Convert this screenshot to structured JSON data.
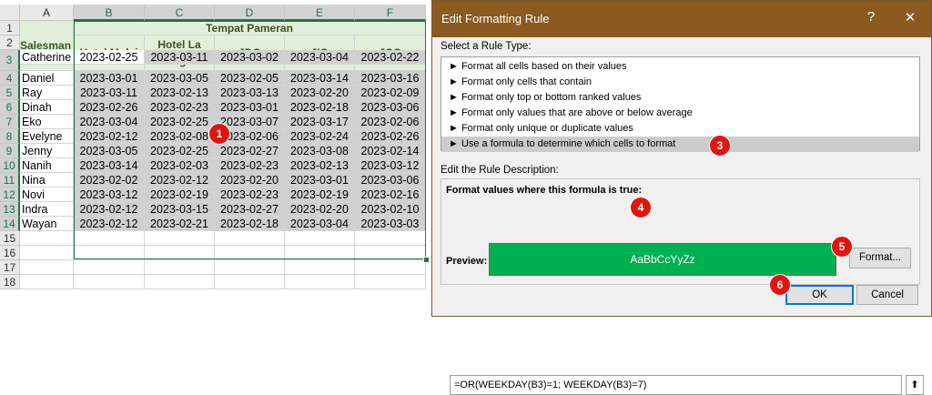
{
  "spreadsheet": {
    "column_letters": [
      "A",
      "B",
      "C",
      "D",
      "E",
      "F"
    ],
    "row_numbers": [
      "1",
      "2",
      "3",
      "4",
      "5",
      "6",
      "7",
      "8",
      "9",
      "10",
      "11",
      "12",
      "13",
      "14",
      "15",
      "16",
      "17",
      "18"
    ],
    "merged_header": "Tempat Pameran",
    "salesman_header": "Salesman",
    "venue_headers": [
      "Hotel Mulai",
      "Hotel La Sangrai",
      "JDC",
      "JIC",
      "JCC"
    ],
    "rows": [
      {
        "name": "Catherine",
        "dates": [
          "2023-02-25",
          "2023-03-11",
          "2023-03-02",
          "2023-03-04",
          "2023-02-22"
        ]
      },
      {
        "name": "Daniel",
        "dates": [
          "2023-03-01",
          "2023-03-05",
          "2023-02-05",
          "2023-03-14",
          "2023-03-16"
        ]
      },
      {
        "name": "Ray",
        "dates": [
          "2023-03-11",
          "2023-02-13",
          "2023-03-13",
          "2023-02-20",
          "2023-02-09"
        ]
      },
      {
        "name": "Dinah",
        "dates": [
          "2023-02-26",
          "2023-02-23",
          "2023-03-01",
          "2023-02-18",
          "2023-03-06"
        ]
      },
      {
        "name": "Eko",
        "dates": [
          "2023-03-04",
          "2023-02-25",
          "2023-03-07",
          "2023-03-17",
          "2023-02-06"
        ]
      },
      {
        "name": "Evelyne",
        "dates": [
          "2023-02-12",
          "2023-02-08",
          "2023-02-06",
          "2023-02-24",
          "2023-02-26"
        ]
      },
      {
        "name": "Jenny",
        "dates": [
          "2023-03-05",
          "2023-02-25",
          "2023-02-27",
          "2023-03-08",
          "2023-02-14"
        ]
      },
      {
        "name": "Nanih",
        "dates": [
          "2023-03-14",
          "2023-02-03",
          "2023-02-23",
          "2023-02-13",
          "2023-03-12"
        ]
      },
      {
        "name": "Nina",
        "dates": [
          "2023-02-02",
          "2023-02-12",
          "2023-02-20",
          "2023-03-01",
          "2023-03-06"
        ]
      },
      {
        "name": "Novi",
        "dates": [
          "2023-03-12",
          "2023-02-19",
          "2023-02-23",
          "2023-02-19",
          "2023-02-16"
        ]
      },
      {
        "name": "Indra",
        "dates": [
          "2023-02-12",
          "2023-03-15",
          "2023-02-27",
          "2023-02-20",
          "2023-02-10"
        ]
      },
      {
        "name": "Wayan",
        "dates": [
          "2023-02-12",
          "2023-02-21",
          "2023-02-18",
          "2023-03-04",
          "2023-03-03"
        ]
      }
    ]
  },
  "dialog": {
    "title": "Edit Formatting Rule",
    "help_glyph": "?",
    "close_glyph": "✕",
    "select_rule_type_label": "Select a Rule Type:",
    "rule_types": [
      "► Format all cells based on their values",
      "► Format only cells that contain",
      "► Format only top or bottom ranked values",
      "► Format only values that are above or below average",
      "► Format only unique or duplicate values",
      "► Use a formula to determine which cells to format"
    ],
    "edit_description_label": "Edit the Rule Description:",
    "formula_label": "Format values where this formula is true:",
    "formula_value": "=OR(WEEKDAY(B3)=1; WEEKDAY(B3)=7)",
    "collapse_glyph": "⬆",
    "preview_label": "Preview:",
    "preview_sample": "AaBbCcYyZz",
    "format_button": "Format...",
    "ok_button": "OK",
    "cancel_button": "Cancel"
  },
  "callouts": [
    "1",
    "2",
    "3",
    "4",
    "5",
    "6"
  ],
  "colors": {
    "accent_excel": "#217346",
    "dialog_titlebar": "#8a5a1f",
    "preview_fill": "#00b050",
    "callout": "#e3140e",
    "header_fill": "#e2efda"
  }
}
